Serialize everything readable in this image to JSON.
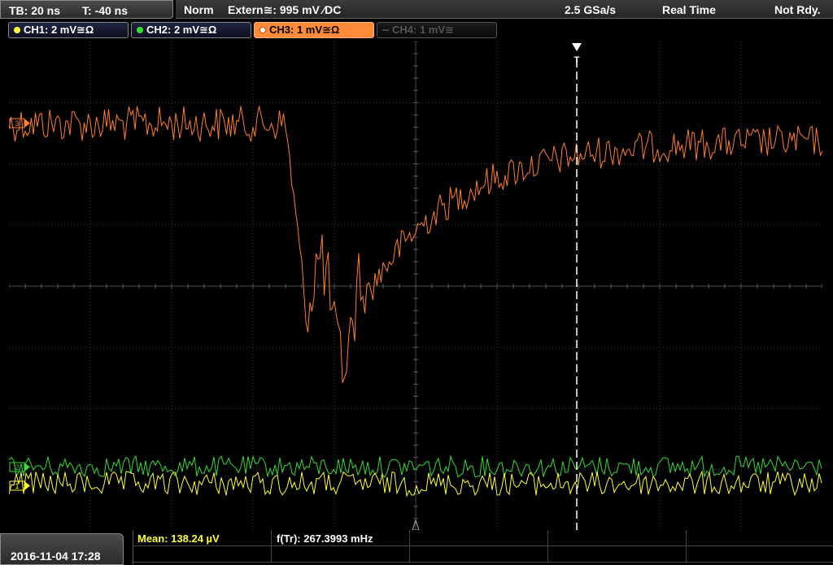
{
  "top": {
    "timebase": "TB: 20 ns",
    "trigger_pos": "T: -40 ns",
    "mode": "Norm",
    "trigger_source": "Extern≅: 995 mV ∕DC",
    "sample_rate": "2.5 GSa/s",
    "acq_mode": "Real Time",
    "status": "Not Rdy."
  },
  "channels": [
    {
      "label": "CH1: 2 mV≅Ω",
      "color": "#ffff33",
      "active": false,
      "enabled": true
    },
    {
      "label": "CH2: 2 mV≅Ω",
      "color": "#33dd33",
      "active": false,
      "enabled": true
    },
    {
      "label": "CH3: 1 mV≅Ω",
      "color": "#ff7f2a",
      "active": true,
      "enabled": true
    },
    {
      "label": "CH4: 1 mV≅",
      "color": "#555555",
      "active": false,
      "enabled": false
    }
  ],
  "markers": {
    "ch1": "1",
    "ch2": "2",
    "ch3": "3",
    "trigger": "T"
  },
  "bottom": {
    "datetime": "2016-11-04 17:28",
    "measurements": [
      {
        "label": "Mean: 138.24 µV",
        "color": "#ffff33"
      },
      {
        "label": "f(Tr): 267.3993 mHz",
        "color": "#ffffff"
      }
    ]
  },
  "colors": {
    "ch1": "#ffff33",
    "ch2": "#33dd33",
    "ch3": "#ff7f2a",
    "grid": "#3a3a3a"
  },
  "trace_shape": {
    "ch3_baseline_div": 1.0,
    "ch3_dip_min_div": 4.6,
    "trigger_time_div": 6.98,
    "dip_start_time_div": 3.4
  }
}
